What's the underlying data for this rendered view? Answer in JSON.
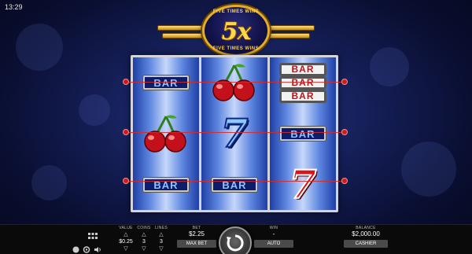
{
  "status_bar": {
    "time": "13:29"
  },
  "logo": {
    "main": "5x",
    "arc_text": "FIVE TIMES WINS"
  },
  "reels": [
    {
      "symbols": [
        {
          "type": "bar",
          "label": "BAR"
        },
        {
          "type": "cherry"
        },
        {
          "type": "bar",
          "label": "BAR"
        }
      ]
    },
    {
      "symbols": [
        {
          "type": "cherry"
        },
        {
          "type": "seven",
          "label": "7",
          "color": "blue"
        },
        {
          "type": "bar",
          "label": "BAR"
        }
      ]
    },
    {
      "symbols": [
        {
          "type": "triple-bar",
          "label": "BAR"
        },
        {
          "type": "bar",
          "label": "BAR"
        },
        {
          "type": "seven",
          "label": "7",
          "color": "red"
        }
      ]
    }
  ],
  "paylines": 3,
  "controls": {
    "value": {
      "label": "VALUE",
      "amount": "$0.25"
    },
    "coins": {
      "label": "COINS",
      "amount": "3"
    },
    "lines": {
      "label": "LINES",
      "amount": "3"
    },
    "bet": {
      "label": "BET",
      "amount": "$2.25"
    },
    "max_bet_label": "MAX BET",
    "win": {
      "label": "WIN",
      "amount": "-"
    },
    "auto_label": "AUTO",
    "balance": {
      "label": "BALANCE",
      "amount": "$2,000.00"
    },
    "cashier_label": "CASHIER"
  },
  "colors": {
    "payline": "#d42a2a",
    "reel_blue": "#1f3fa6",
    "accent_gold": "#e2ad2b"
  }
}
